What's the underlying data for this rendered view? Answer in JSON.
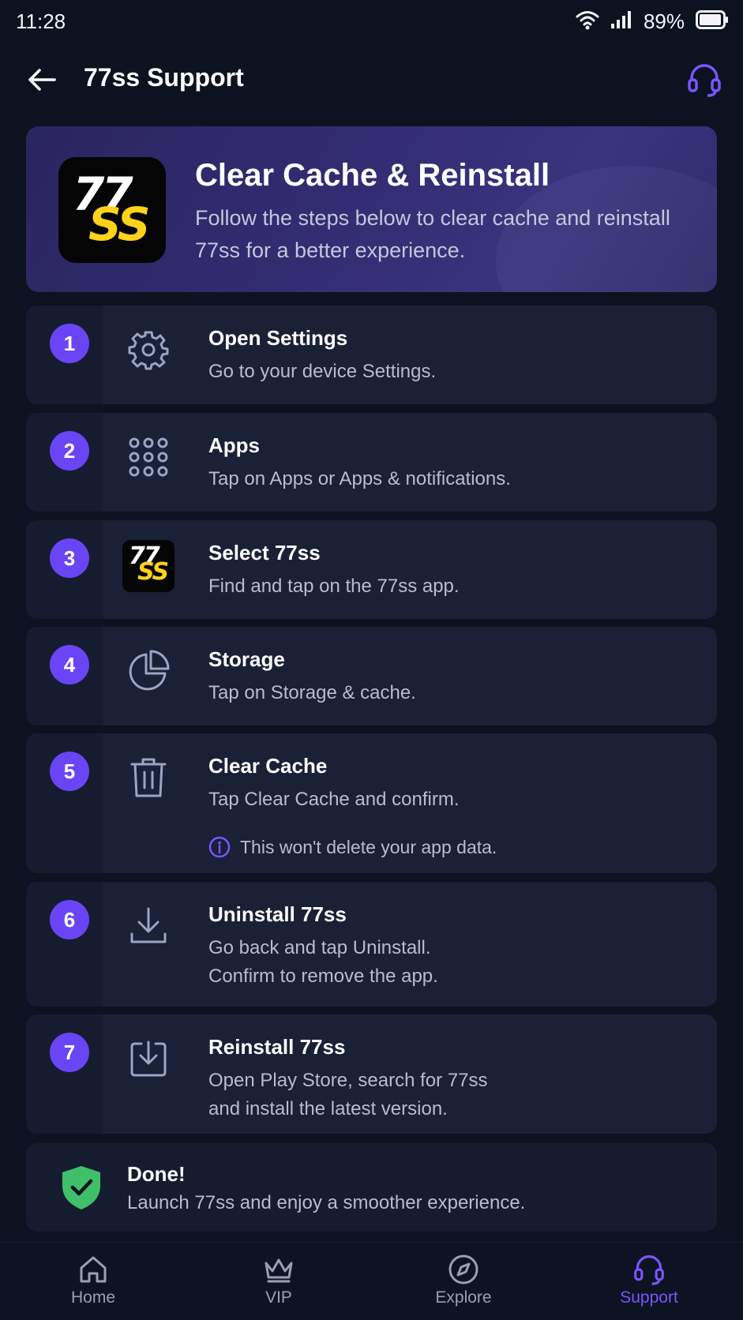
{
  "status_bar": {
    "time": "11:28",
    "battery": "89%"
  },
  "header": {
    "title": "77ss Support"
  },
  "hero": {
    "title": "Clear Cache & Reinstall",
    "description": "Follow the steps below to clear cache and reinstall 77ss for a better experience.",
    "logo_top": "77",
    "logo_bottom": "SS"
  },
  "steps": [
    {
      "number": "1",
      "icon": "gear-icon",
      "title": "Open Settings",
      "description": "Go to your device Settings."
    },
    {
      "number": "2",
      "icon": "apps-grid-icon",
      "title": "Apps",
      "description": "Tap on Apps or Apps & notifications."
    },
    {
      "number": "3",
      "icon": "app-logo-icon",
      "title": "Select 77ss",
      "description": "Find and tap on the 77ss app.",
      "logo_top": "77",
      "logo_bottom": "SS"
    },
    {
      "number": "4",
      "icon": "pie-chart-icon",
      "title": "Storage",
      "description": "Tap on Storage & cache."
    },
    {
      "number": "5",
      "icon": "trash-icon",
      "title": "Clear Cache",
      "description": "Tap Clear Cache and confirm.",
      "note": "This won't delete your app data."
    },
    {
      "number": "6",
      "icon": "download-icon",
      "title": "Uninstall 77ss",
      "description_lines": [
        "Go back and tap Uninstall.",
        "Confirm to remove the app."
      ]
    },
    {
      "number": "7",
      "icon": "install-box-icon",
      "title": "Reinstall 77ss",
      "description_lines": [
        "Open Play Store, search for 77ss",
        "and install the latest version."
      ]
    }
  ],
  "done": {
    "title": "Done!",
    "description": "Launch 77ss and enjoy a smoother experience.",
    "icon": "shield-check-icon"
  },
  "nav": [
    {
      "label": "Home",
      "icon": "home-icon",
      "active": false
    },
    {
      "label": "VIP",
      "icon": "crown-icon",
      "active": false
    },
    {
      "label": "Explore",
      "icon": "compass-icon",
      "active": false
    },
    {
      "label": "Support",
      "icon": "headset-icon",
      "active": true
    }
  ],
  "colors": {
    "accent": "#6a45f5",
    "active_nav": "#7a55ff",
    "background": "#0c1220",
    "logo_yellow": "#ffd21a",
    "done_green": "#3fbf6a"
  }
}
